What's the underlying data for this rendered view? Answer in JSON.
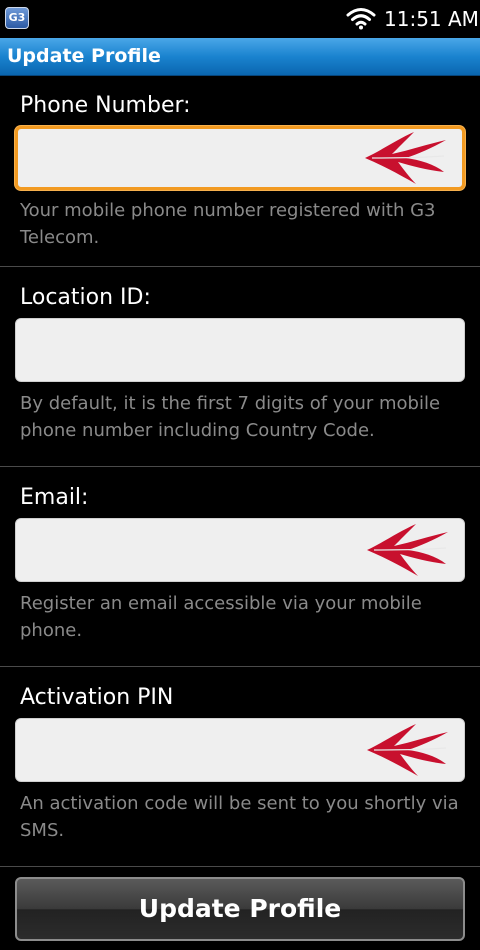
{
  "status_bar": {
    "app_badge": "G3",
    "time": "11:51 AM"
  },
  "header": {
    "title": "Update Profile"
  },
  "form": {
    "fields": [
      {
        "label": "Phone Number:",
        "value": "",
        "help": "Your mobile phone number registered with G3 Telecom.",
        "required_marker": true,
        "focused": true
      },
      {
        "label": "Location ID:",
        "value": "",
        "help": "By default, it is the first 7 digits of your mobile phone number including Country Code.",
        "required_marker": false,
        "focused": false
      },
      {
        "label": "Email:",
        "value": "",
        "help": "Register an email accessible via your mobile phone.",
        "required_marker": true,
        "focused": false
      },
      {
        "label": "Activation PIN",
        "value": "",
        "help": "An activation code will be sent to you shortly via SMS.",
        "required_marker": true,
        "focused": false
      }
    ],
    "submit_label": "Update Profile"
  },
  "colors": {
    "title_bar": "#1a83cf",
    "focus_border": "#f29a21",
    "arrow": "#c8102e",
    "help_text": "#8a8a8a"
  },
  "icons": {
    "status_wifi": "wifi-icon",
    "required": "red-arrow-icon"
  }
}
